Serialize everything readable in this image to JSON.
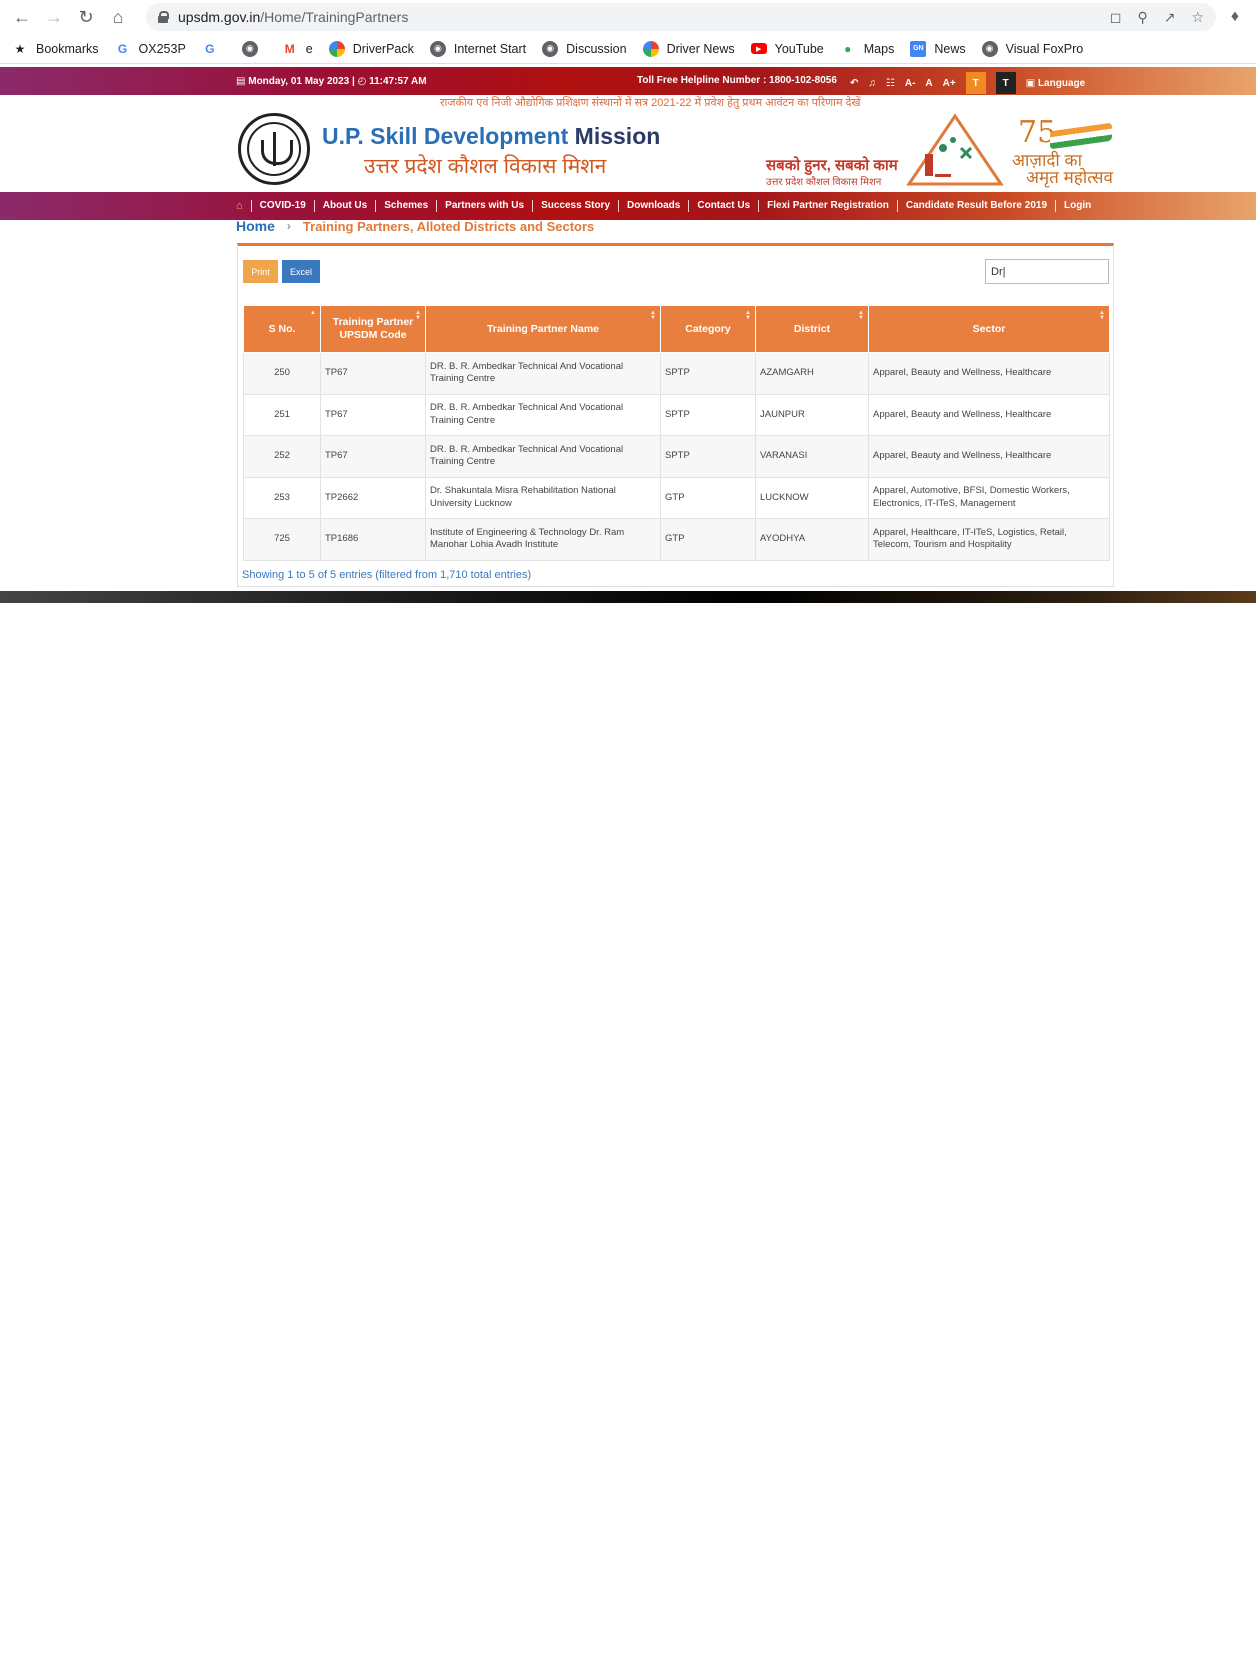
{
  "browser": {
    "url_host": "upsdm.gov.in",
    "url_path": "/Home/TrainingPartners",
    "bookmarks": [
      {
        "label": "Bookmarks",
        "icon": "star-icon"
      },
      {
        "label": "OX253P",
        "icon": "google-icon"
      },
      {
        "label": "",
        "icon": "google-icon"
      },
      {
        "label": "",
        "icon": "globe-icon"
      },
      {
        "label": "e",
        "icon": "gmail-icon"
      },
      {
        "label": "DriverPack",
        "icon": "driverpack-icon"
      },
      {
        "label": "Internet Start",
        "icon": "globe-icon"
      },
      {
        "label": "Discussion",
        "icon": "globe-icon"
      },
      {
        "label": "Driver News",
        "icon": "driverpack-icon"
      },
      {
        "label": "YouTube",
        "icon": "youtube-icon"
      },
      {
        "label": "Maps",
        "icon": "maps-icon"
      },
      {
        "label": "News",
        "icon": "google-news-icon"
      },
      {
        "label": "Visual FoxPro",
        "icon": "globe-icon"
      }
    ]
  },
  "topbar": {
    "date": "Monday, 01 May 2023",
    "time": "11:47:57 AM",
    "helpline": "Toll Free Helpline Number : 1800-102-8056",
    "font_small": "A-",
    "font_normal": "A",
    "font_large": "A+",
    "theme_light": "T",
    "theme_dark": "T",
    "language": "Language"
  },
  "header": {
    "marquee": "राजकीय एवं निजी औद्योगिक प्रशिक्षण संस्थानों में सत्र 2021-22 में प्रवेश हेतु प्रथम आवंटन का परिणाम देखें",
    "brand_en_1": "U.P. Skill Development",
    "brand_en_2": "Mission",
    "brand_hi": "उत्तर प्रदेश कौशल विकास मिशन",
    "slogan": "सबको हुनर, सबको काम",
    "slogan_sub": "उत्तर प्रदेश कौशल विकास मिशन",
    "azadi_75": "75",
    "azadi_line1": "आज़ादी का",
    "azadi_line2": "अमृत महोत्सव"
  },
  "nav": {
    "items": [
      "COVID-19",
      "About Us",
      "Schemes",
      "Partners with Us",
      "Success Story",
      "Downloads",
      "Contact Us",
      "Flexi Partner Registration",
      "Candidate Result Before 2019",
      "Login"
    ]
  },
  "breadcrumb": {
    "home": "Home",
    "current": "Training Partners, Alloted Districts and Sectors"
  },
  "table": {
    "print_label": "Print",
    "excel_label": "Excel",
    "search_value": "Dr|",
    "headers": [
      "S No.",
      "Training Partner UPSDM Code",
      "Training Partner Name",
      "Category",
      "District",
      "Sector"
    ],
    "rows": [
      [
        "250",
        "TP67",
        "DR. B. R. Ambedkar Technical And Vocational Training Centre",
        "SPTP",
        "AZAMGARH",
        "Apparel, Beauty and Wellness, Healthcare"
      ],
      [
        "251",
        "TP67",
        "DR. B. R. Ambedkar Technical And Vocational Training Centre",
        "SPTP",
        "JAUNPUR",
        "Apparel, Beauty and Wellness, Healthcare"
      ],
      [
        "252",
        "TP67",
        "DR. B. R. Ambedkar Technical And Vocational Training Centre",
        "SPTP",
        "VARANASI",
        "Apparel, Beauty and Wellness, Healthcare"
      ],
      [
        "253",
        "TP2662",
        "Dr. Shakuntala Misra Rehabilitation National University Lucknow",
        "GTP",
        "LUCKNOW",
        "Apparel, Automotive, BFSI, Domestic Workers, Electronics, IT-ITeS, Management"
      ],
      [
        "725",
        "TP1686",
        "Institute of Engineering & Technology Dr. Ram Manohar Lohia Avadh Institute",
        "GTP",
        "AYODHYA",
        "Apparel, Healthcare, IT-ITeS, Logistics, Retail, Telecom, Tourism and Hospitality"
      ]
    ],
    "info": "Showing 1 to 5 of 5 entries (filtered from 1,710 total entries)"
  },
  "colors": {
    "accent_orange": "#e97f3f",
    "brand_blue": "#2a6fb3",
    "excel_blue": "#3a78c0",
    "print_orange": "#f0a54a"
  }
}
